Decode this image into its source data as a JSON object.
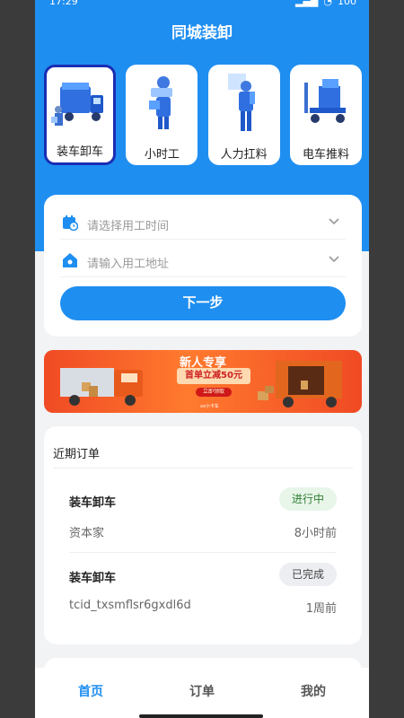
{
  "status": {
    "time": "17:29",
    "battery": "100"
  },
  "header": {
    "title": "同城装卸"
  },
  "services": [
    {
      "label": "装车卸车",
      "icon": "truck-loading-icon"
    },
    {
      "label": "小时工",
      "icon": "hourly-worker-icon"
    },
    {
      "label": "人力扛料",
      "icon": "manual-carry-icon"
    },
    {
      "label": "电车推料",
      "icon": "hand-cart-icon"
    }
  ],
  "form": {
    "time_placeholder": "请选择用工时间",
    "address_placeholder": "请输入用工地址",
    "next_label": "下一步"
  },
  "banner": {
    "title": "新人专享",
    "subtitle": "首单立减50元",
    "button": "立即领取",
    "footnote": "xx小卡车"
  },
  "orders": {
    "title": "近期订单",
    "items": [
      {
        "title": "装车卸车",
        "status": "进行中",
        "customer": "资本家",
        "time": "8小时前"
      },
      {
        "title": "装车卸车",
        "status": "已完成",
        "customer": "tcid_txsmflsr6gxdl6d",
        "time": "1周前"
      }
    ]
  },
  "tabs": [
    {
      "label": "首页"
    },
    {
      "label": "订单"
    },
    {
      "label": "我的"
    }
  ],
  "colors": {
    "brand_blue": "#1f8ef1",
    "selected_border": "#1a2db3",
    "status_in_progress": "#2e7d32",
    "banner_orange": "#f04a24"
  }
}
